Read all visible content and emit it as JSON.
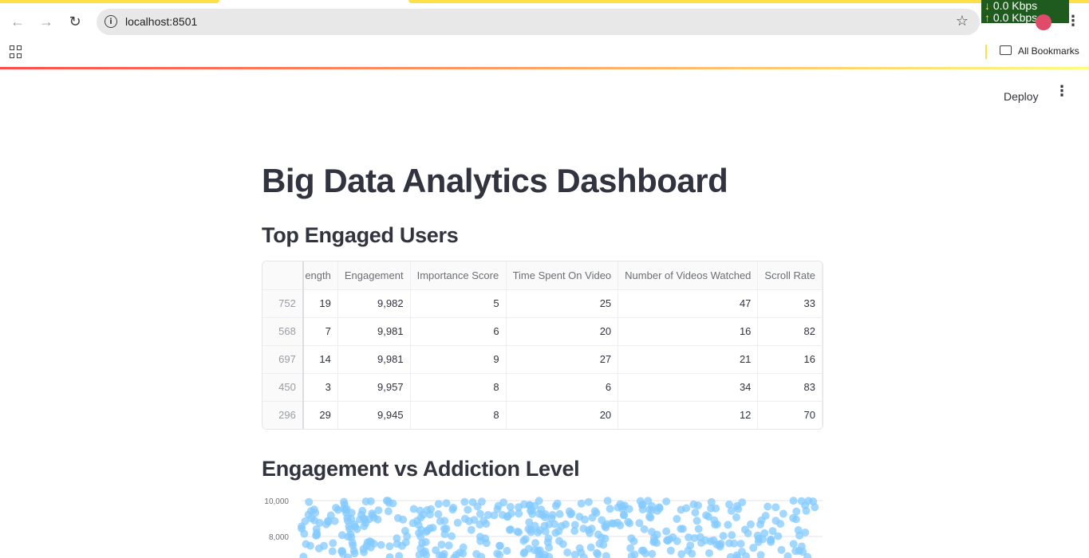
{
  "browser": {
    "url": "localhost:8501",
    "net_down": "0.0 Kbps",
    "net_up": "0.0 Kbps",
    "bookmarks_label": "All Bookmarks"
  },
  "header": {
    "deploy_label": "Deploy"
  },
  "page": {
    "title": "Big Data Analytics Dashboard",
    "section1_title": "Top Engaged Users",
    "section2_title": "Engagement vs Addiction Level"
  },
  "table": {
    "columns": [
      "ength",
      "Engagement",
      "Importance Score",
      "Time Spent On Video",
      "Number of Videos Watched",
      "Scroll Rate"
    ],
    "rows": [
      {
        "index": "752",
        "cells": [
          "19",
          "9,982",
          "5",
          "25",
          "47",
          "33"
        ]
      },
      {
        "index": "568",
        "cells": [
          "7",
          "9,981",
          "6",
          "20",
          "16",
          "82"
        ]
      },
      {
        "index": "697",
        "cells": [
          "14",
          "9,981",
          "9",
          "27",
          "21",
          "16"
        ]
      },
      {
        "index": "450",
        "cells": [
          "3",
          "9,957",
          "8",
          "6",
          "34",
          "83"
        ]
      },
      {
        "index": "296",
        "cells": [
          "29",
          "9,945",
          "8",
          "20",
          "12",
          "70"
        ]
      }
    ]
  },
  "chart_data": {
    "type": "scatter",
    "y_ticks": [
      "10,000",
      "8,000"
    ],
    "ylim": [
      7000,
      10000
    ],
    "color": "#83c9ff"
  },
  "colors": {
    "accent_gradient_start": "#ff4b4b",
    "accent_gradient_end": "#fffd80",
    "tab_highlight": "#fde047",
    "speed_bg": "#1f5a1f"
  }
}
